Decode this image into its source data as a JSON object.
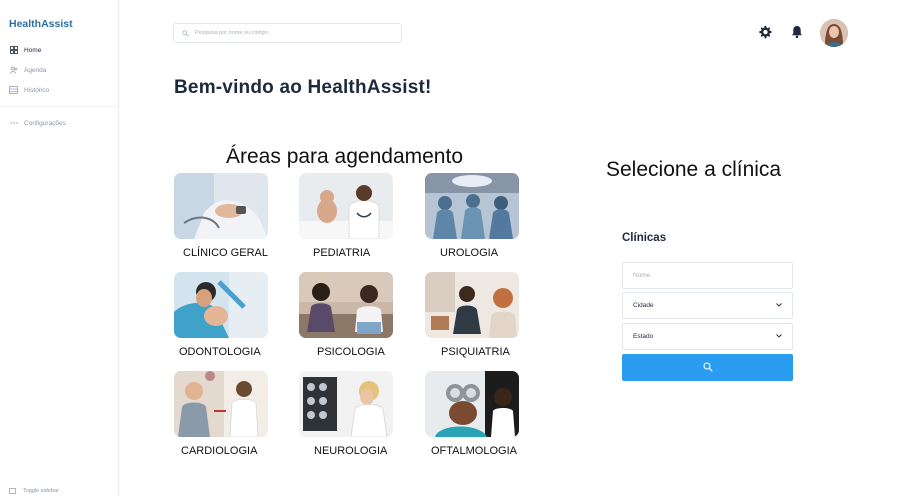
{
  "sidebar": {
    "brand": "HealthAssist",
    "items": [
      {
        "label": "Home",
        "icon": "dashboard-icon"
      },
      {
        "label": "Agenda",
        "icon": "users-icon"
      },
      {
        "label": "Histórico",
        "icon": "list-icon"
      }
    ],
    "settings": {
      "label": "Configurações",
      "icon": "more-icon"
    },
    "toggle": "Toggle sidebar"
  },
  "header": {
    "search_placeholder": "Pesquisa por nome ou código",
    "icons": [
      "settings-icon",
      "bell-icon",
      "avatar"
    ]
  },
  "main": {
    "welcome": "Bem-vindo ao HealthAssist!",
    "areas_title": "Áreas para agendamento",
    "areas": [
      {
        "label": "CLÍNICO GERAL"
      },
      {
        "label": "PEDIATRIA"
      },
      {
        "label": "UROLOGIA"
      },
      {
        "label": "ODONTOLOGIA"
      },
      {
        "label": "PSICOLOGIA"
      },
      {
        "label": "PSIQUIATRIA"
      },
      {
        "label": "CARDIOLOGIA"
      },
      {
        "label": "NEUROLOGIA"
      },
      {
        "label": "OFTALMOLOGIA"
      }
    ]
  },
  "clinic": {
    "title": "Selecione a clínica",
    "section_label": "Clínicas",
    "name_placeholder": "Nome",
    "city": "Cidade",
    "state": "Estado"
  },
  "colors": {
    "brand": "#2d6fa3",
    "accent": "#2b9df0",
    "text": "#1e2a3b"
  }
}
